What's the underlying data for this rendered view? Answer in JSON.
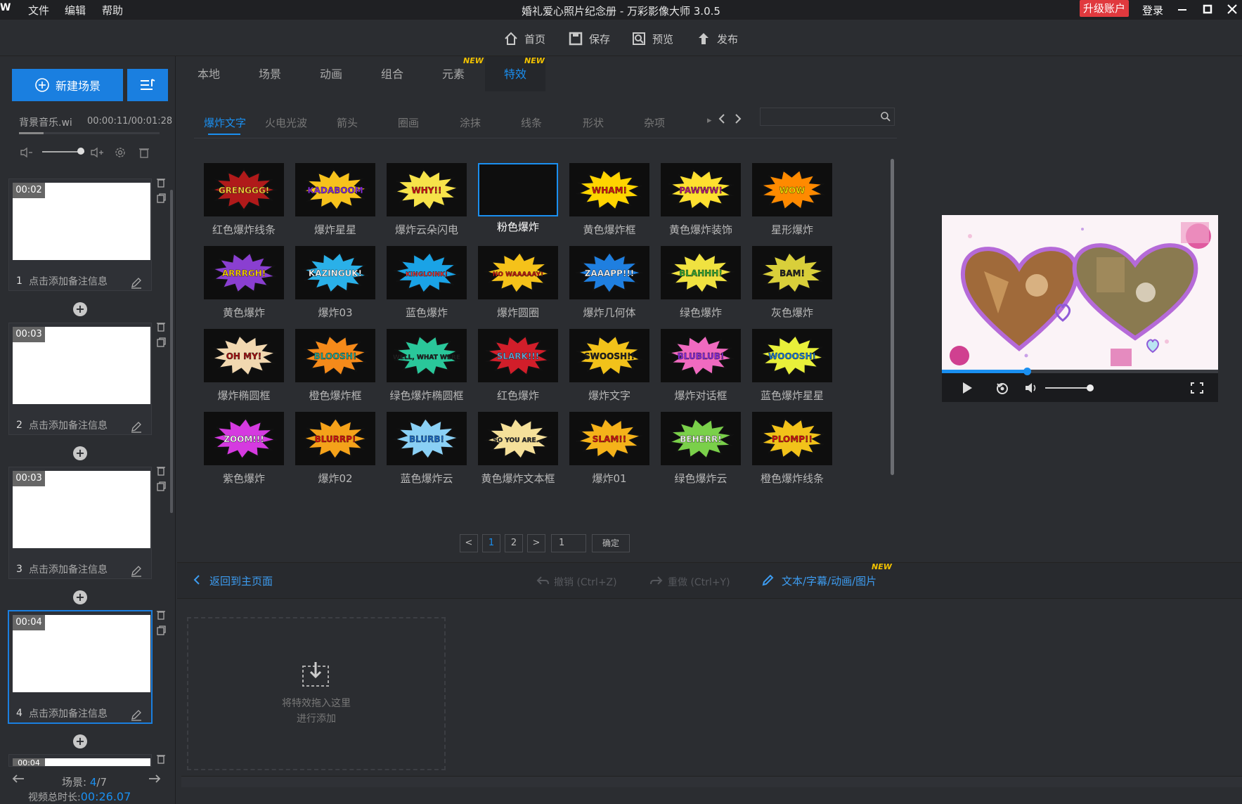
{
  "app": {
    "logo": "W",
    "menus": [
      "文件",
      "编辑",
      "帮助"
    ],
    "window_title": "婚礼爱心照片纪念册 - 万彩影像大师 3.0.5",
    "upgrade_label": "升级账户",
    "login_label": "登录"
  },
  "toolbar": {
    "home": "首页",
    "save": "保存",
    "preview": "预览",
    "publish": "发布"
  },
  "left": {
    "new_scene": "新建场景",
    "bgm": {
      "name": "背景音乐.wi",
      "time": "00:00:11/00:01:28"
    },
    "scenes": [
      {
        "dur": "00:02",
        "index": "1",
        "note": "点击添加备注信息"
      },
      {
        "dur": "00:03",
        "index": "2",
        "note": "点击添加备注信息"
      },
      {
        "dur": "00:03",
        "index": "3",
        "note": "点击添加备注信息"
      },
      {
        "dur": "00:04",
        "index": "4",
        "note": "点击添加备注信息"
      }
    ],
    "partial_scene_dur": "00:04",
    "scene_label": "场景:",
    "scene_current": "4",
    "scene_sep": "/",
    "scene_total": "7",
    "total_label": "视频总时长:",
    "total_value": "00:26.07"
  },
  "library": {
    "main_tabs": [
      "本地",
      "场景",
      "动画",
      "组合",
      "元素",
      "特效"
    ],
    "new_badge": "NEW",
    "sub_tabs": [
      "爆炸文字",
      "火电光波",
      "箭头",
      "圈画",
      "涂抹",
      "线条",
      "形状",
      "杂项"
    ],
    "effects": [
      {
        "label": "红色爆炸线条",
        "text": "GRENGGG!",
        "bg": "#b01a1a",
        "fg": "#ffd23a"
      },
      {
        "label": "爆炸星星",
        "text": "KADABOOM",
        "bg": "#f7c21c",
        "fg": "#8a2be2"
      },
      {
        "label": "爆炸云朵闪电",
        "text": "WHY!!",
        "bg": "#f7e34a",
        "fg": "#d11"
      },
      {
        "label": "粉色爆炸",
        "text": "",
        "bg": "#0e0e0e",
        "fg": "#fff"
      },
      {
        "label": "黄色爆炸框",
        "text": "WHAM!",
        "bg": "#ffd400",
        "fg": "#d11"
      },
      {
        "label": "黄色爆炸装饰",
        "text": "PAWWW!",
        "bg": "#ffe030",
        "fg": "#c01880"
      },
      {
        "label": "星形爆炸",
        "text": "WOW",
        "bg": "#ff8a00",
        "fg": "#ffe600"
      },
      {
        "label": "黄色爆炸",
        "text": "ARRRGH!",
        "bg": "#8a3fd1",
        "fg": "#ffd400"
      },
      {
        "label": "爆炸03",
        "text": "KAZINGUK!",
        "bg": "#2ab0e8",
        "fg": "#fff"
      },
      {
        "label": "蓝色爆炸",
        "text": "KINGLOINK!",
        "bg": "#1aa3e6",
        "fg": "#f33"
      },
      {
        "label": "爆炸圆圈",
        "text": "NO WAAAAAY!",
        "bg": "#f5c21a",
        "fg": "#d11"
      },
      {
        "label": "爆炸几何体",
        "text": "ZAAAPP!!!",
        "bg": "#1f7fe0",
        "fg": "#fff"
      },
      {
        "label": "绿色爆炸",
        "text": "BLAHHH!",
        "bg": "#f0e240",
        "fg": "#3a3"
      },
      {
        "label": "灰色爆炸",
        "text": "BAM!",
        "bg": "#d9cf3a",
        "fg": "#222"
      },
      {
        "label": "爆炸椭圆框",
        "text": "OH MY!",
        "bg": "#f2d8b0",
        "fg": "#a11"
      },
      {
        "label": "橙色爆炸框",
        "text": "BLOOSH!",
        "bg": "#f58a1a",
        "fg": "#2a9"
      },
      {
        "label": "绿色爆炸椭圆框",
        "text": "WELL, WHAT WERE",
        "bg": "#2ac79a",
        "fg": "#222"
      },
      {
        "label": "红色爆炸",
        "text": "SLARK!!!",
        "bg": "#d11e2a",
        "fg": "#6ad"
      },
      {
        "label": "爆炸文字",
        "text": "SWOOSH!!",
        "bg": "#f2c21a",
        "fg": "#222"
      },
      {
        "label": "爆炸对话框",
        "text": "BLUBLUB!",
        "bg": "#f06ac0",
        "fg": "#8a2be2"
      },
      {
        "label": "蓝色爆炸星星",
        "text": "WOOOSH!",
        "bg": "#e8f03a",
        "fg": "#1a7fe0"
      },
      {
        "label": "紫色爆炸",
        "text": "ZOOM!!!",
        "bg": "#d53ae0",
        "fg": "#fff"
      },
      {
        "label": "爆炸02",
        "text": "BLURRP!",
        "bg": "#f5a21a",
        "fg": "#d11"
      },
      {
        "label": "蓝色爆炸云",
        "text": "BLURB!",
        "bg": "#8ad0f5",
        "fg": "#1a6fd0"
      },
      {
        "label": "黄色爆炸文本框",
        "text": "SO YOU ARE...",
        "bg": "#f5e09a",
        "fg": "#333"
      },
      {
        "label": "爆炸01",
        "text": "SLAM!!",
        "bg": "#f5b21a",
        "fg": "#d11"
      },
      {
        "label": "绿色爆炸云",
        "text": "BEHERR!",
        "bg": "#7ad04a",
        "fg": "#fff"
      },
      {
        "label": "橙色爆炸线条",
        "text": "PLOMP!!",
        "bg": "#f2c21a",
        "fg": "#d11"
      }
    ],
    "pagination": {
      "prev": "<",
      "pages": [
        "1",
        "2"
      ],
      "next": ">",
      "input": "1",
      "confirm": "确定"
    }
  },
  "actions": {
    "back_home": "返回到主页面",
    "undo": "撤销 (Ctrl+Z)",
    "redo": "重做 (Ctrl+Y)",
    "text_subtitle": "文本/字幕/动画/图片"
  },
  "dropzone": {
    "line1": "将特效拖入这里",
    "line2": "进行添加"
  },
  "preview": {
    "progress": 0.31
  }
}
